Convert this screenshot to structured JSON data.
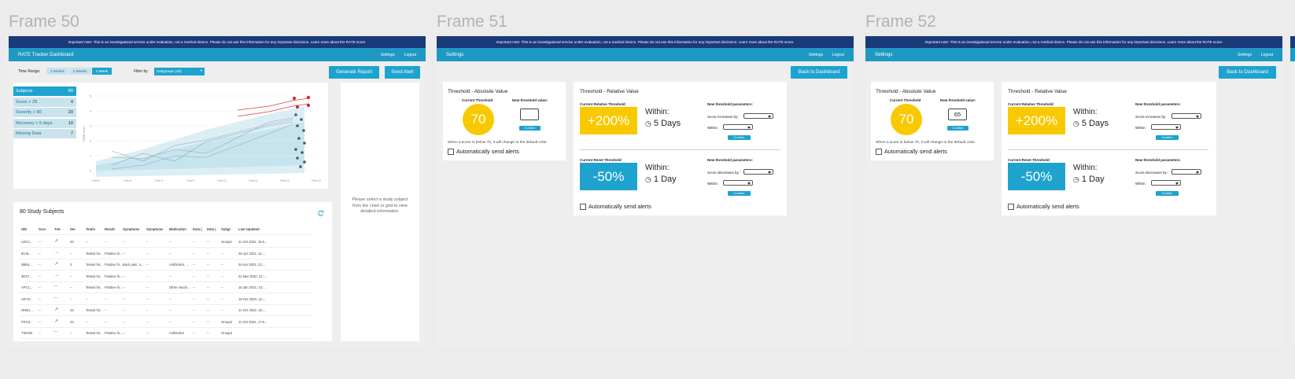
{
  "frames": [
    {
      "title": "Frame 50"
    },
    {
      "title": "Frame 51"
    },
    {
      "title": "Frame 52"
    }
  ],
  "notice": "Important note: This is an investigational service under evaluation, not a medical device. Please do not use this information for any important decisions. Learn more about the RATE score.",
  "nav": {
    "settings": "Settings",
    "logout": "Logout"
  },
  "dashboard": {
    "app_title": "RATE Tracker Dashboard",
    "time_range_label": "Time Range:",
    "time_ranges": [
      "3 Weeks",
      "2 Weeks",
      "1 Week"
    ],
    "filter_label": "Filter by",
    "filter_value": "Subgroups (All)",
    "generate_report": "Generate Report",
    "send_alert": "Send Alert",
    "sidebar": [
      {
        "label": "Subjects",
        "count": "80"
      },
      {
        "label": "Score > 29",
        "count": "4"
      },
      {
        "label": "Severity > 80",
        "count": "20"
      },
      {
        "label": "Recovery > 5 days",
        "count": "10"
      },
      {
        "label": "Missing Data",
        "count": "7"
      }
    ],
    "detail_placeholder": "Please select a study subject from the chart or grid to view detailed information.",
    "table_title": "80 Study Subjects",
    "columns": [
      "UID",
      "Scor",
      "Trer",
      "Dei",
      "Testin",
      "Result",
      "Symptoms",
      "Symptoms",
      "Medication",
      "Data (",
      "Data (",
      "Subgr",
      "Last Updated"
    ],
    "rows": [
      [
        "LDC4...",
        "--",
        "↗",
        "23",
        "--",
        "--",
        "--",
        "--",
        "--",
        "--",
        "--",
        "Group1",
        "11 Oct 2022, 15:5..."
      ],
      [
        "IEA8...",
        "--",
        "→",
        "--",
        "Tested for...",
        "Positive fo...",
        "--",
        "--",
        "--",
        "--",
        "--",
        "--",
        "26 Apr 2022, 12:..."
      ],
      [
        "3BK6...",
        "--",
        "↗",
        "2",
        "Tested for...",
        "Positive fo...",
        "Back pain, n...",
        "--",
        "Antibiotics, ...",
        "--",
        "--",
        "--",
        "26 Apr 2022, 13:..."
      ],
      [
        "3EX7...",
        "--",
        "→",
        "--",
        "Tested for...",
        "Positive fo...",
        "--",
        "--",
        "--",
        "--",
        "--",
        "--",
        "22 Mar 2022, 21:..."
      ],
      [
        "APC1...",
        "--",
        "--",
        "--",
        "Tested for...",
        "Positive fo...",
        "--",
        "--",
        "Other vaccin...",
        "--",
        "--",
        "--",
        "18 Jan 2021, 13:..."
      ],
      [
        "ADY5...",
        "--",
        "--",
        "--",
        "--",
        "--",
        "--",
        "--",
        "--",
        "--",
        "--",
        "--",
        "19 Oct 2020, 12:..."
      ],
      [
        "ONB1...",
        "--",
        "↗",
        "23",
        "Tested for...",
        "--",
        "--",
        "--",
        "--",
        "--",
        "--",
        "--",
        "12 Oct 2022, 18:..."
      ],
      [
        "FDC8...",
        "--",
        "↗",
        "23",
        "--",
        "--",
        "--",
        "--",
        "--",
        "--",
        "--",
        "Group2",
        "11 Oct 2022, 17:0..."
      ],
      [
        "TIK01B",
        "--",
        "--",
        "--",
        "Tested for...",
        "Positive fo...",
        "--",
        "--",
        "Antibiotics",
        "--",
        "--",
        "Group3",
        ""
      ]
    ],
    "chart_ticks": [
      "Feb 6",
      "Feb 8",
      "Feb 9",
      "Feb 9",
      "Feb 10",
      "Feb 11",
      "Feb 12",
      "Feb 13"
    ],
    "ytick": [
      "5",
      "4",
      "3",
      "2",
      "1",
      "0"
    ],
    "ylabel": "RATE Score"
  },
  "settings": {
    "app_title": "Settings",
    "back_button": "Back to Dashboard",
    "abs_title": "Threshold - Absolute Value",
    "current_threshold_label": "Current Threshold",
    "new_threshold_label": "New threshold value:",
    "current_value": "70",
    "confirm": "Confirm",
    "below_note": "When a score is below 70, it will change to the default color.",
    "auto_alerts": "Automatically send alerts",
    "rel_title": "Threshold - Relative Value",
    "rel_current_label": "Current Relative Threshold",
    "rel_value": "+200%",
    "within_label": "Within:",
    "rel_within": "5 Days",
    "new_params": "New threshold parameters:",
    "score_increases": "Score increases by:",
    "within_short": "Within:",
    "reset_current_label": "Current Reset Threshold",
    "reset_value": "-50%",
    "reset_within": "1 Day",
    "score_decreases": "Score decreases by:",
    "frame52_input_value": "65"
  }
}
